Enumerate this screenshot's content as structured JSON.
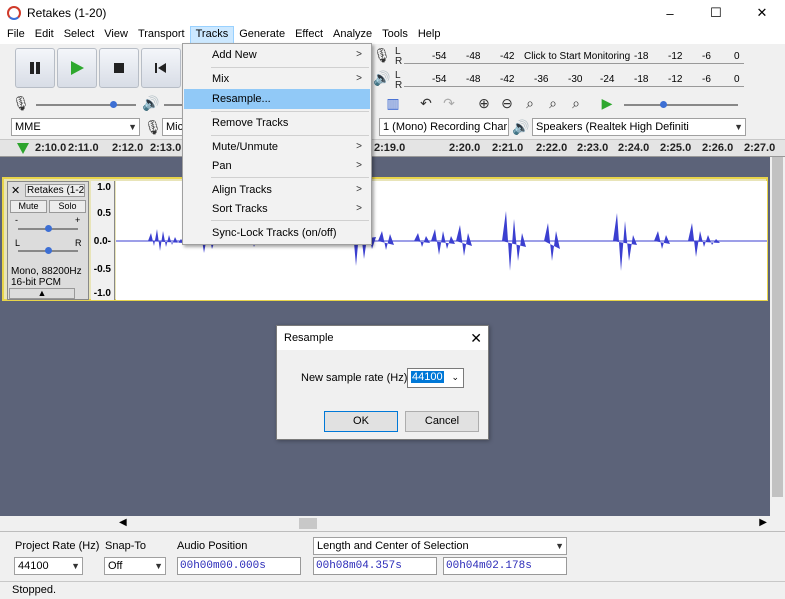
{
  "window": {
    "title": "Retakes (1-20)",
    "minimize": "–",
    "maximize": "☐",
    "close": "✕"
  },
  "menubar": [
    "File",
    "Edit",
    "Select",
    "View",
    "Transport",
    "Tracks",
    "Generate",
    "Effect",
    "Analyze",
    "Tools",
    "Help"
  ],
  "active_menu": "Tracks",
  "transport": {
    "pause_icon": "pause-icon",
    "play_icon": "play-icon",
    "stop_icon": "stop-icon",
    "skip_start_icon": "skip-start-icon"
  },
  "meters": {
    "record_scale": [
      "-54",
      "-48",
      "-42",
      "Click to Start Monitoring",
      "-18",
      "-12",
      "-6",
      "0"
    ],
    "play_scale": [
      "-54",
      "-48",
      "-42",
      "-36",
      "-30",
      "-24",
      "-18",
      "-12",
      "-6",
      "0"
    ],
    "lr": [
      "L",
      "R"
    ]
  },
  "device": {
    "host": "MME",
    "mic_partial": "Mic",
    "channels": "1 (Mono) Recording Char",
    "speakers": "Speakers (Realtek High Definiti"
  },
  "timeline": [
    "2:10.0",
    "2:11.0",
    "2:12.0",
    "2:13.0",
    "2:19.0",
    "2:20.0",
    "2:21.0",
    "2:22.0",
    "2:23.0",
    "2:24.0",
    "2:25.0",
    "2:26.0",
    "2:27.0"
  ],
  "track": {
    "name": "Retakes (1-2",
    "mute": "Mute",
    "solo": "Solo",
    "gain_minus": "-",
    "gain_plus": "+",
    "pan_l": "L",
    "pan_r": "R",
    "info_line1": "Mono, 88200Hz",
    "info_line2": "16-bit PCM",
    "scale": [
      "1.0",
      "0.5",
      "0.0-",
      "-0.5",
      "-1.0"
    ]
  },
  "tracks_menu": {
    "items": [
      {
        "label": "Add New",
        "submenu": true
      },
      {
        "label": "Mix",
        "submenu": true
      },
      {
        "label": "Resample...",
        "submenu": false,
        "highlighted": true
      },
      {
        "label": "Remove Tracks",
        "submenu": false
      },
      {
        "label": "Mute/Unmute",
        "submenu": true
      },
      {
        "label": "Pan",
        "submenu": true
      },
      {
        "label": "Align Tracks",
        "submenu": true
      },
      {
        "label": "Sort Tracks",
        "submenu": true
      },
      {
        "label": "Sync-Lock Tracks (on/off)",
        "submenu": false
      }
    ]
  },
  "resample_dialog": {
    "title": "Resample",
    "label": "New sample rate (Hz):",
    "value": "44100",
    "ok": "OK",
    "cancel": "Cancel"
  },
  "selection_toolbar": {
    "project_rate_label": "Project Rate (Hz)",
    "project_rate": "44100",
    "snap_label": "Snap-To",
    "snap": "Off",
    "audio_position_label": "Audio Position",
    "audio_position": "00h00m00.000s",
    "selection_mode": "Length and Center of Selection",
    "length": "00h08m04.357s",
    "center": "00h04m02.178s"
  },
  "status": "Stopped."
}
